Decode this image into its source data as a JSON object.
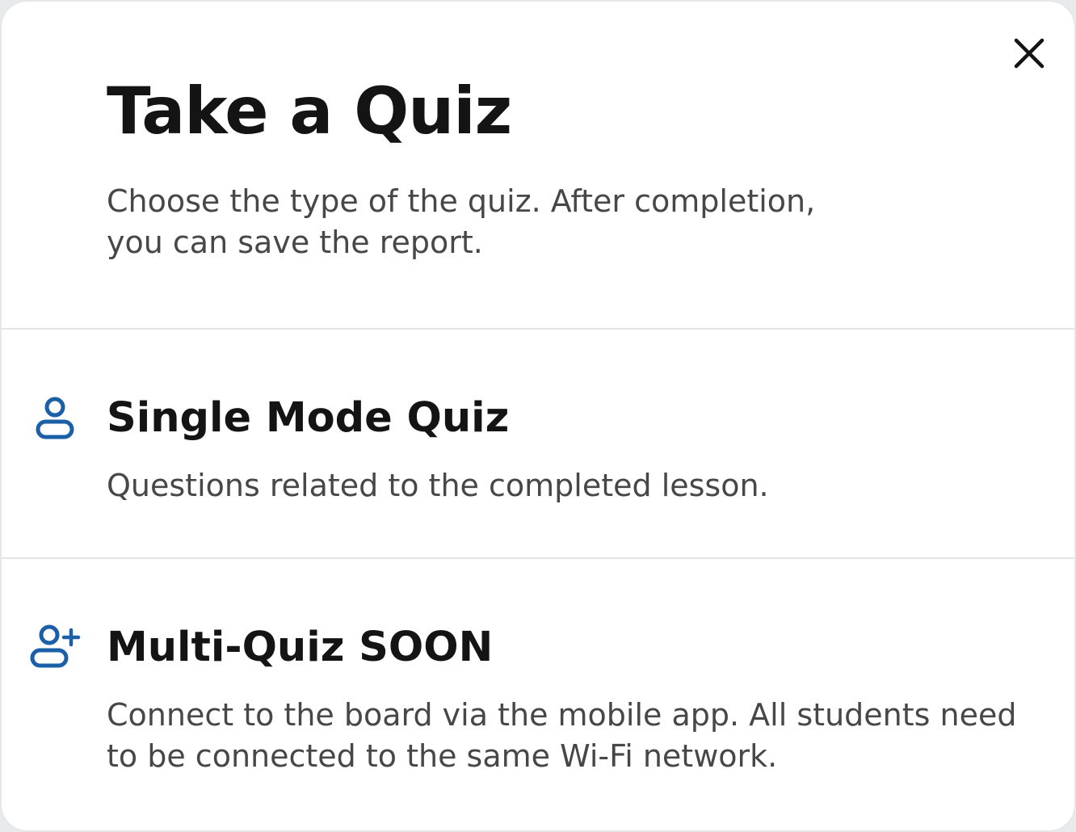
{
  "dialog": {
    "title": "Take a Quiz",
    "subtitle": "Choose the type of the quiz. After completion, you can save the report.",
    "close_icon": "close-icon"
  },
  "options": [
    {
      "icon": "user-icon",
      "title": "Single Mode Quiz",
      "description": "Questions related to the completed lesson."
    },
    {
      "icon": "user-plus-icon",
      "title": "Multi-Quiz SOON",
      "description": "Connect to the board via the mobile app. All students need to be connected to the same Wi-Fi network."
    }
  ],
  "colors": {
    "icon_accent": "#1a5fa8",
    "title_text": "#141414",
    "body_text": "#474747",
    "divider": "#e4e5e8"
  }
}
